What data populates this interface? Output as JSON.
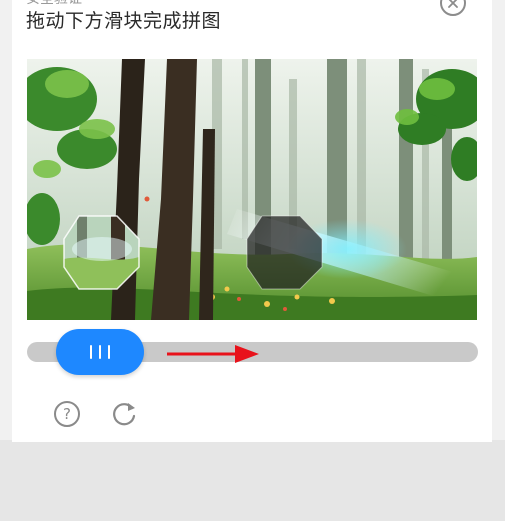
{
  "dialog": {
    "cut_title": "安全验证",
    "title": "拖动下方滑块完成拼图",
    "close_icon": "close-circle-icon"
  },
  "puzzle": {
    "image": "misty-forest-sunbeam",
    "piece_shape": "octagon",
    "piece_icon": "octagon-puzzle-piece",
    "hole_icon": "octagon-puzzle-hole"
  },
  "slider": {
    "progress": 0,
    "handle_icon": "three-bar-grip-icon",
    "hint_icon": "right-arrow-icon",
    "accent_color": "#1e88ff",
    "track_color": "#c9c9c9",
    "hint_color": "#e8121b"
  },
  "footer": {
    "help_label": "?",
    "help_icon": "question-circle-icon",
    "refresh_icon": "refresh-icon"
  }
}
